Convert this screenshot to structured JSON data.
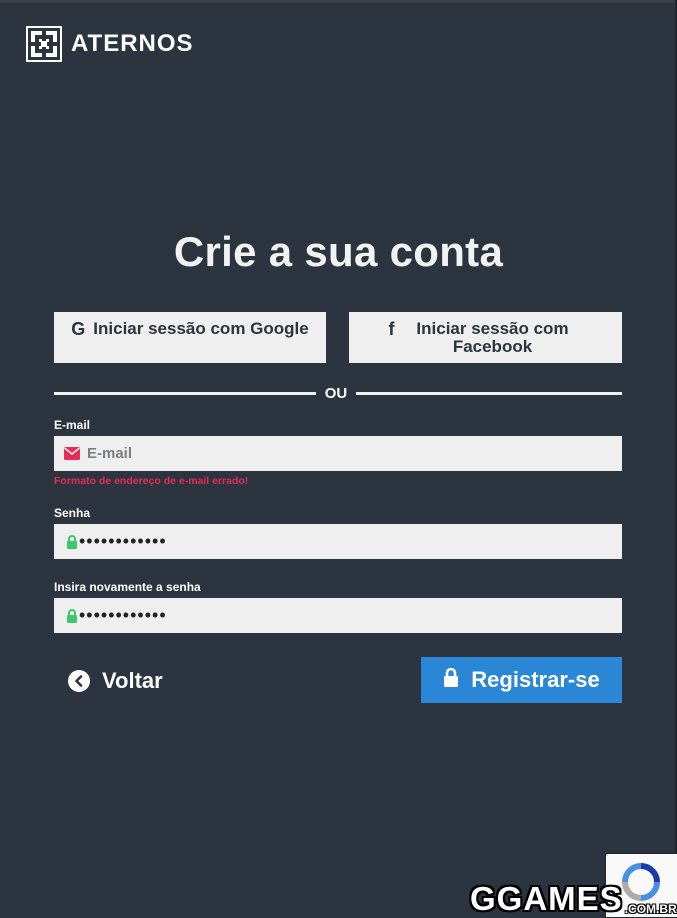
{
  "brand": {
    "name": "ATERNOS"
  },
  "page": {
    "title": "Crie a sua conta"
  },
  "social": {
    "google_label": "Iniciar sessão com Google",
    "facebook_label": "Iniciar sessão com Facebook"
  },
  "divider_text": "OU",
  "form": {
    "email": {
      "label": "E-mail",
      "placeholder": "E-mail",
      "value": "",
      "error": "Formato de endereço de e-mail errado!"
    },
    "password": {
      "label": "Senha",
      "value": "••••••••••••"
    },
    "password_confirm": {
      "label": "Insira novamente a senha",
      "value": "••••••••••••"
    }
  },
  "actions": {
    "back_label": "Voltar",
    "register_label": "Registrar-se"
  },
  "watermark": {
    "main": "GGAMES",
    "sub": ".COM.BR"
  },
  "colors": {
    "background": "#2b343f",
    "field_bg": "#efefef",
    "primary": "#2a87d6",
    "error": "#e52d57",
    "lock_icon": "#3fc46f"
  },
  "icons": {
    "logo": "aternos-logo-icon",
    "google": "google-icon",
    "facebook": "facebook-icon",
    "email": "envelope-icon",
    "password": "lock-icon",
    "back": "chevron-left-circle-icon",
    "register": "lock-icon",
    "captcha": "recaptcha-icon"
  }
}
